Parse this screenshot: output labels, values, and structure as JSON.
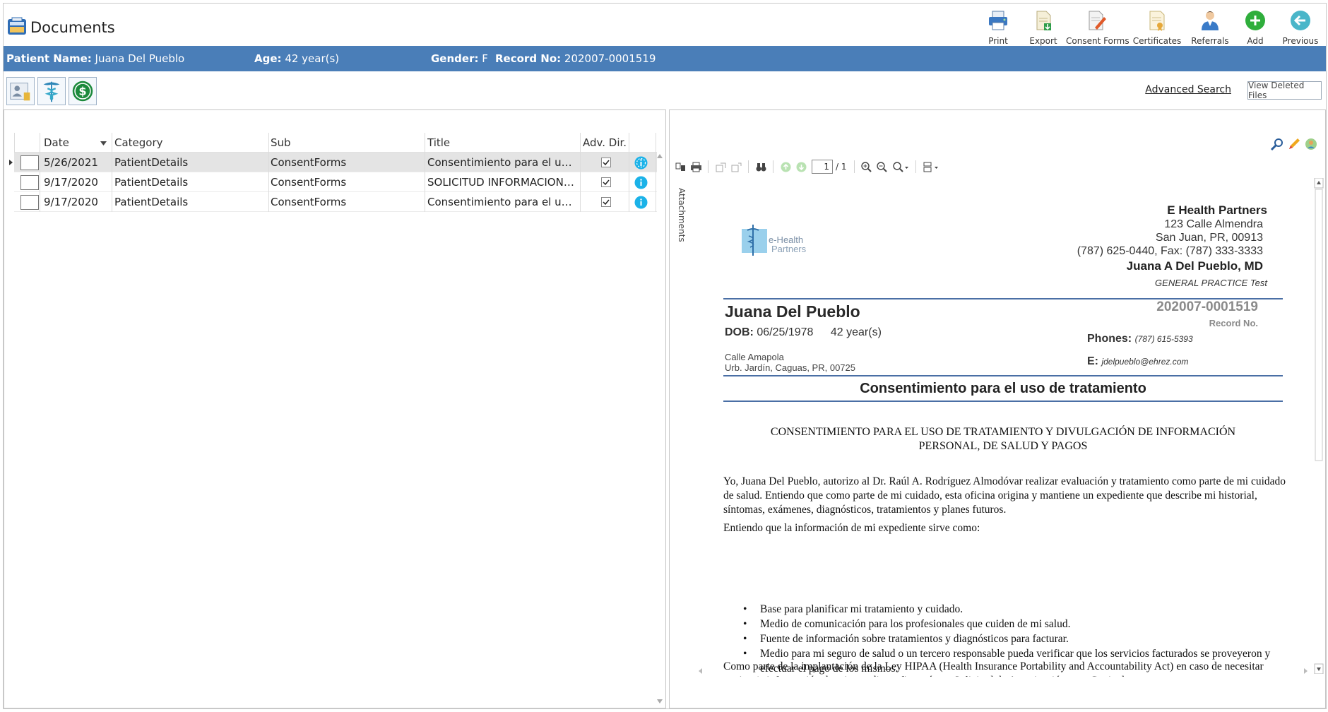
{
  "app": {
    "title": "Documents"
  },
  "toolbar": {
    "print": "Print",
    "export": "Export",
    "consent_forms": "Consent Forms",
    "certificates": "Certificates",
    "referrals": "Referrals",
    "add": "Add",
    "previous": "Previous"
  },
  "patient_bar": {
    "name_label": "Patient Name:",
    "name_value": "Juana Del Pueblo",
    "age_label": "Age:",
    "age_value": "42 year(s)",
    "gender_label": "Gender:",
    "gender_value": "F",
    "record_label": "Record No:",
    "record_value": "202007-0001519"
  },
  "actions": {
    "advanced_search": "Advanced Search",
    "view_deleted": "View Deleted Files"
  },
  "grid": {
    "columns": [
      "Date",
      "Category",
      "Sub",
      "Title",
      "Adv. Dir."
    ],
    "rows": [
      {
        "date": "5/26/2021",
        "category": "PatientDetails",
        "sub": "ConsentForms",
        "title": "Consentimiento para el uso de tratamiento",
        "adv_dir": true,
        "selected": true
      },
      {
        "date": "9/17/2020",
        "category": "PatientDetails",
        "sub": "ConsentForms",
        "title": "SOLICITUD INFORMACION PERSONAL",
        "adv_dir": true,
        "selected": false
      },
      {
        "date": "9/17/2020",
        "category": "PatientDetails",
        "sub": "ConsentForms",
        "title": "Consentimiento para el uso de tratamiento",
        "adv_dir": true,
        "selected": false
      }
    ]
  },
  "viewer": {
    "page_current": "1",
    "page_total": "/ 1",
    "attachments_tab": "Attachments"
  },
  "document": {
    "logo_text_1": "e-Health",
    "logo_text_2": "Partners",
    "org_name": "E Health Partners",
    "org_address_1": "123 Calle Almendra",
    "org_address_2": "San Juan, PR, 00913",
    "org_phone": "(787) 625-0440, Fax: (787) 333-3333",
    "doctor_name": "Juana A Del Pueblo, MD",
    "specialty": "GENERAL PRACTICE Test",
    "patient_name": "Juana Del Pueblo",
    "dob_label": "DOB:",
    "dob_value": "06/25/1978",
    "age": "42 year(s)",
    "address_1": "Calle Amapola",
    "address_2": "Urb. Jardín, Caguas, PR, 00725",
    "record_no": "202007-0001519",
    "record_label": "Record No.",
    "phones_label": "Phones:",
    "phones_value": "(787) 615-5393",
    "email_label": "E:",
    "email_value": "jdelpueblo@ehrez.com",
    "title": "Consentimiento para el uso de tratamiento",
    "caps_title_1": "CONSENTIMIENTO PARA EL USO DE TRATAMIENTO Y DIVULGACIÓN DE INFORMACIÓN",
    "caps_title_2": "PERSONAL, DE SALUD Y PAGOS",
    "para_1": "Yo, Juana Del Pueblo, autorizo al Dr. Raúl A. Rodríguez Almodóvar realizar evaluación y tratamiento como parte de mi cuidado de salud.  Entiendo que como parte de mi cuidado, esta oficina origina y mantiene un expediente que describe mi historial, síntomas, exámenes, diagnósticos, tratamientos y planes futuros.",
    "para_2": "Entiendo que la información de mi expediente sirve como:",
    "bullets": [
      "Base para planificar mi tratamiento y cuidado.",
      "Medio de comunicación para los profesionales que cuiden de mi salud.",
      "Fuente de información sobre tratamientos y diagnósticos para facturar.",
      "Medio para mi seguro de salud o un tercero responsable pueda verificar que los servicios     facturados se proveyeron y efectuar el pago de los mismos."
    ],
    "para_3": "Como parte de la implantación de la Ley HIPAA (Health Insurance Portability and Accountability Act) en caso de necesitar copia y/o información de mi expediente firmaré una Solicitud de Autorización para Copia de"
  }
}
